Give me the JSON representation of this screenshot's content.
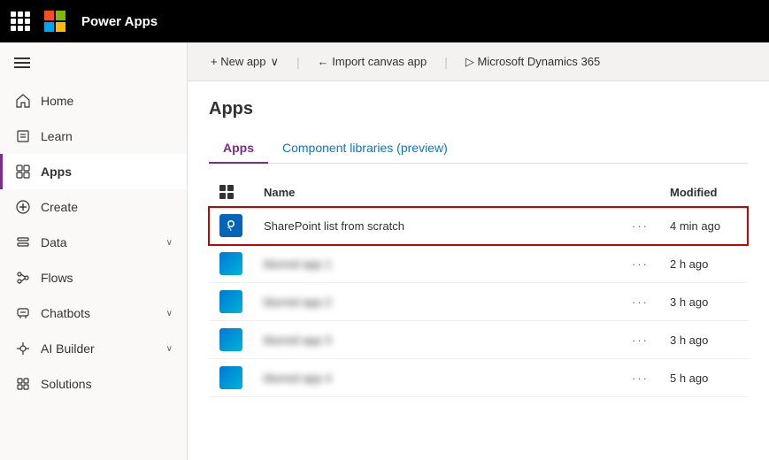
{
  "topbar": {
    "title": "Power Apps",
    "grid_icon_label": "waffle-menu"
  },
  "sidebar": {
    "toggle_label": "Collapse sidebar",
    "items": [
      {
        "id": "home",
        "label": "Home",
        "icon": "home-icon",
        "has_chevron": false,
        "active": false
      },
      {
        "id": "learn",
        "label": "Learn",
        "icon": "learn-icon",
        "has_chevron": false,
        "active": false
      },
      {
        "id": "apps",
        "label": "Apps",
        "icon": "apps-icon",
        "has_chevron": false,
        "active": true
      },
      {
        "id": "create",
        "label": "Create",
        "icon": "create-icon",
        "has_chevron": false,
        "active": false
      },
      {
        "id": "data",
        "label": "Data",
        "icon": "data-icon",
        "has_chevron": true,
        "active": false
      },
      {
        "id": "flows",
        "label": "Flows",
        "icon": "flows-icon",
        "has_chevron": false,
        "active": false
      },
      {
        "id": "chatbots",
        "label": "Chatbots",
        "icon": "chatbots-icon",
        "has_chevron": true,
        "active": false
      },
      {
        "id": "ai-builder",
        "label": "AI Builder",
        "icon": "ai-builder-icon",
        "has_chevron": true,
        "active": false
      },
      {
        "id": "solutions",
        "label": "Solutions",
        "icon": "solutions-icon",
        "has_chevron": false,
        "active": false
      }
    ]
  },
  "action_bar": {
    "new_app_label": "+ New app",
    "new_app_chevron": "∨",
    "import_label": "← Import canvas app",
    "dynamics_label": "▷ Microsoft Dynamics 365"
  },
  "page": {
    "title": "Apps",
    "tabs": [
      {
        "id": "apps-tab",
        "label": "Apps",
        "active": true
      },
      {
        "id": "component-tab",
        "label": "Component libraries (preview)",
        "active": false
      }
    ],
    "table": {
      "col_name": "Name",
      "col_modified": "Modified",
      "rows": [
        {
          "id": "sharepoint-row",
          "name": "SharePoint list from scratch",
          "time": "4 min ago",
          "icon_type": "sharepoint",
          "highlighted": true,
          "blurred": false
        },
        {
          "id": "row-2",
          "name": "blurred app 1",
          "time": "2 h ago",
          "icon_type": "blue",
          "highlighted": false,
          "blurred": true
        },
        {
          "id": "row-3",
          "name": "blurred app 2",
          "time": "3 h ago",
          "icon_type": "blue",
          "highlighted": false,
          "blurred": true
        },
        {
          "id": "row-4",
          "name": "blurred app 3",
          "time": "3 h ago",
          "icon_type": "blue",
          "highlighted": false,
          "blurred": true
        },
        {
          "id": "row-5",
          "name": "blurred app 4",
          "time": "5 h ago",
          "icon_type": "blue",
          "highlighted": false,
          "blurred": true
        }
      ]
    }
  }
}
